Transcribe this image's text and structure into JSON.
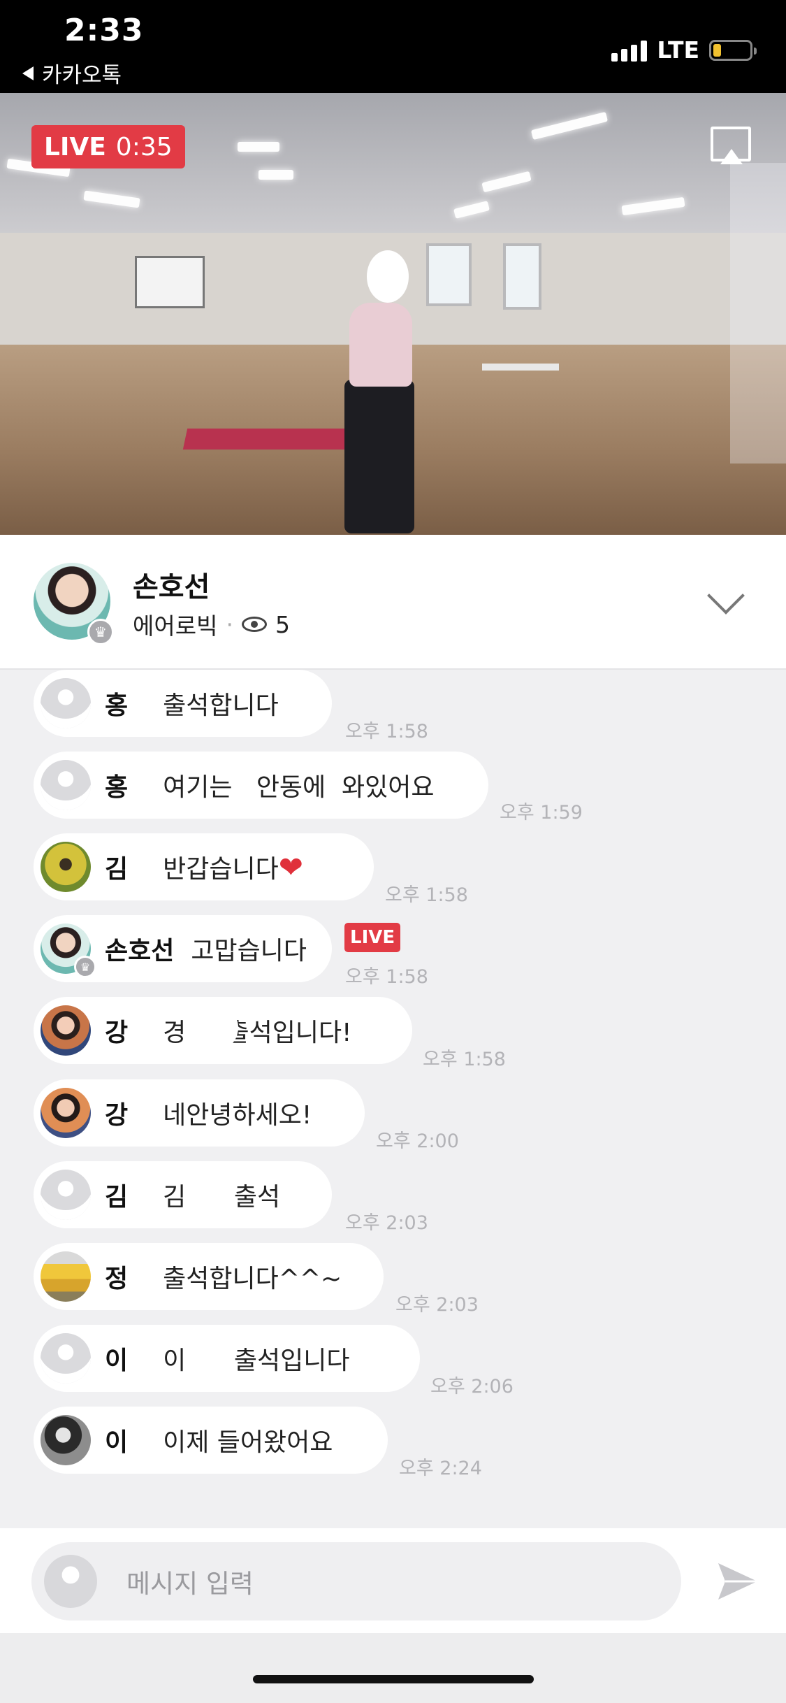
{
  "status_bar": {
    "time": "2:33",
    "back_app": "카카오톡",
    "network": "LTE",
    "battery_level": 0.22
  },
  "video": {
    "live_label": "LIVE",
    "elapsed": "0:35"
  },
  "host": {
    "name": "손호선",
    "category": "에어로빅",
    "separator": "·",
    "viewer_count": "5"
  },
  "chat": {
    "messages": [
      {
        "name": "홍",
        "text": "출석합니다",
        "time": "오후 1:58"
      },
      {
        "name": "홍",
        "text": "여기는   안동에  와있어요",
        "time": "오후 1:59"
      },
      {
        "name": "김",
        "text": "반갑습니다",
        "time": "오후 1:58",
        "emoji": "❤"
      },
      {
        "name": "손호선",
        "text": "고맙습니다",
        "time": "오후 1:58",
        "badge": "LIVE"
      },
      {
        "name": "강",
        "text": "경     출석입니다!",
        "time": "오후 1:58"
      },
      {
        "name": "강",
        "text": "네안녕하세오!",
        "time": "오후 2:00"
      },
      {
        "name": "김",
        "text": "김      출석",
        "time": "오후 2:03"
      },
      {
        "name": "정",
        "text": "출석합니다^^~",
        "time": "오후 2:03"
      },
      {
        "name": "이",
        "text": "이      출석입니다",
        "time": "오후 2:06"
      },
      {
        "name": "이",
        "text": "이제 들어왔어요",
        "time": "오후 2:24"
      }
    ]
  },
  "input": {
    "placeholder": "메시지 입력"
  },
  "colors": {
    "live_red": "#e23b45",
    "chat_bg": "#f0f0f2",
    "time_gray": "#b3b3b7"
  },
  "icons": [
    "back-arrow-icon",
    "signal-icon",
    "battery-icon",
    "airplay-icon",
    "eye-icon",
    "crown-icon",
    "chevron-down-icon",
    "send-icon"
  ]
}
